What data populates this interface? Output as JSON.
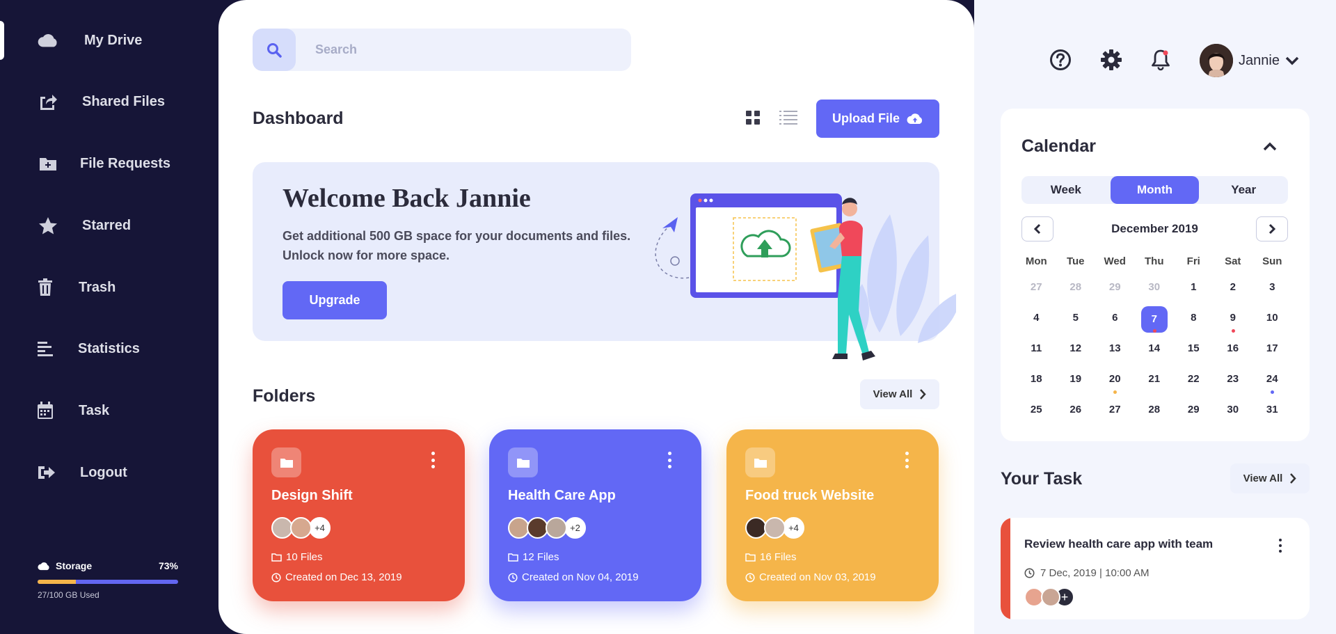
{
  "sidebar": {
    "items": [
      {
        "label": "My Drive",
        "icon": "cloud-icon",
        "active": true
      },
      {
        "label": "Shared Files",
        "icon": "share-icon"
      },
      {
        "label": "File Requests",
        "icon": "folder-plus-icon"
      },
      {
        "label": "Starred",
        "icon": "star-icon"
      },
      {
        "label": "Trash",
        "icon": "trash-icon"
      },
      {
        "label": "Statistics",
        "icon": "statistics-icon"
      },
      {
        "label": "Task",
        "icon": "calendar-icon"
      },
      {
        "label": "Logout",
        "icon": "logout-icon"
      }
    ],
    "storage": {
      "label": "Storage",
      "percent_text": "73%",
      "used_fraction": 0.27,
      "used_text": "27/100 GB Used"
    }
  },
  "search": {
    "placeholder": "Search"
  },
  "dashboard": {
    "title": "Dashboard",
    "upload_label": "Upload File"
  },
  "banner": {
    "title": "Welcome Back Jannie",
    "line1": "Get additional 500 GB space for your documents and files.",
    "line2": "Unlock now for more space.",
    "button": "Upgrade"
  },
  "folders": {
    "title": "Folders",
    "view_all": "View All",
    "items": [
      {
        "name": "Design Shift",
        "more": "+4",
        "files": "10 Files",
        "created": "Created on Dec 13, 2019",
        "color": "#e8513c"
      },
      {
        "name": "Health Care App",
        "more": "+2",
        "files": "12 Files",
        "created": "Created on Nov 04, 2019",
        "color": "#6268f5"
      },
      {
        "name": "Food truck Website",
        "more": "+4",
        "files": "16 Files",
        "created": "Created on Nov 03, 2019",
        "color": "#f5b54a"
      }
    ]
  },
  "user": {
    "name": "Jannie"
  },
  "calendar": {
    "title": "Calendar",
    "tabs": [
      "Week",
      "Month",
      "Year"
    ],
    "active_tab": "Month",
    "month": "December 2019",
    "weekdays": [
      "Mon",
      "Tue",
      "Wed",
      "Thu",
      "Fri",
      "Sat",
      "Sun"
    ],
    "weeks": [
      [
        "27",
        "28",
        "29",
        "30",
        "1",
        "2",
        "3"
      ],
      [
        "4",
        "5",
        "6",
        "7",
        "8",
        "9",
        "10"
      ],
      [
        "11",
        "12",
        "13",
        "14",
        "15",
        "16",
        "17"
      ],
      [
        "18",
        "19",
        "20",
        "21",
        "22",
        "23",
        "24"
      ],
      [
        "25",
        "26",
        "27",
        "28",
        "29",
        "30",
        "31"
      ]
    ],
    "today": "7",
    "accent": "#6268f5"
  },
  "task": {
    "title": "Your Task",
    "view_all": "View All",
    "item": {
      "name": "Review health care app with team",
      "date": "7 Dec, 2019 | 10:00 AM"
    }
  }
}
